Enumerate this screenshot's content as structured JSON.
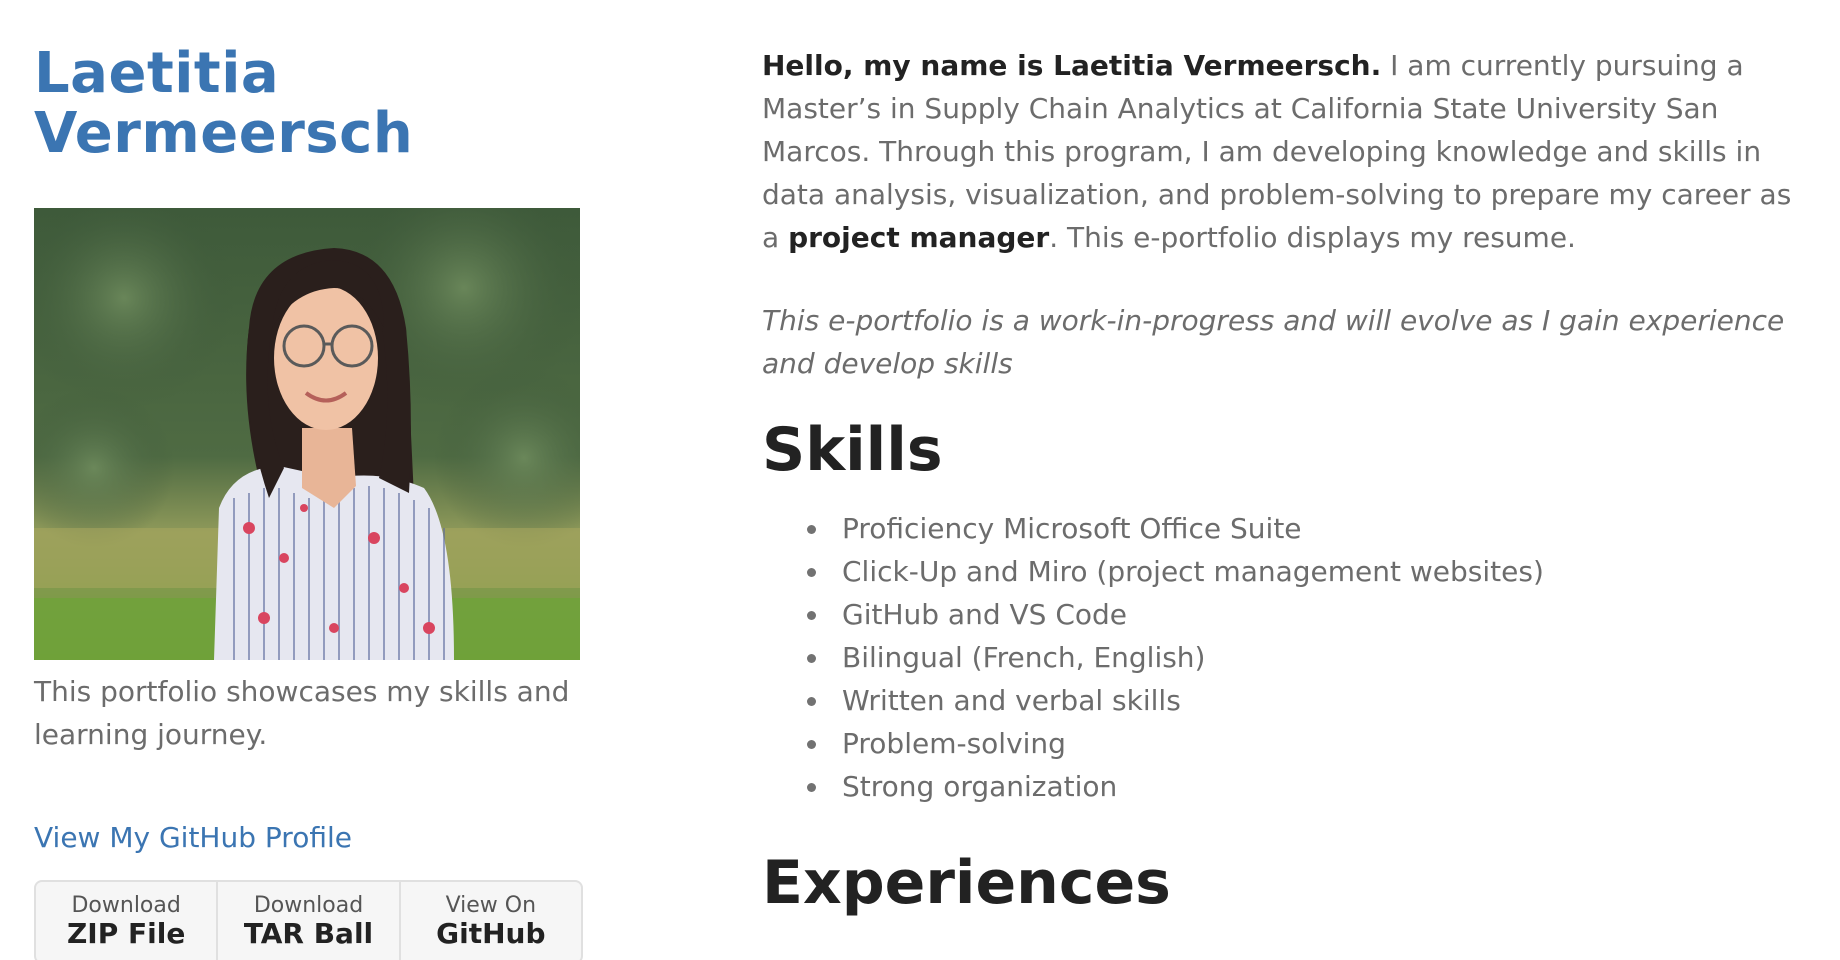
{
  "sidebar": {
    "title_line1": "Laetitia",
    "title_line2": "Vermeersch",
    "photo_alt": "Portrait photo",
    "tagline": "This portfolio showcases my skills and learning journey.",
    "github_link": "View My GitHub Profile",
    "downloads": [
      {
        "top": "Download",
        "bottom": "ZIP File"
      },
      {
        "top": "Download",
        "bottom": "TAR Ball"
      },
      {
        "top": "View On",
        "bottom": "GitHub"
      }
    ]
  },
  "main": {
    "intro_bold": "Hello, my name is Laetitia Vermeersch.",
    "intro_text1": " I am currently pursuing a Master’s in Supply Chain Analytics at California State University San Marcos. Through this program, I am developing knowledge and skills in data analysis, visualization, and problem-solving to prepare my career as a ",
    "intro_bold2": "project manager",
    "intro_text2": ". This e-portfolio displays my resume.",
    "note": "This e-portfolio is a work-in-progress and will evolve as I gain experience and develop skills",
    "skills_heading": "Skills",
    "skills": [
      "Proficiency Microsoft Office Suite",
      "Click-Up and Miro (project management websites)",
      "GitHub and VS Code",
      "Bilingual (French, English)",
      "Written and verbal skills",
      "Problem-solving",
      "Strong organization"
    ],
    "experiences_heading": "Experiences"
  },
  "colors": {
    "accent": "#3b75b2",
    "heading": "#222222",
    "text": "#6c6c6c"
  }
}
